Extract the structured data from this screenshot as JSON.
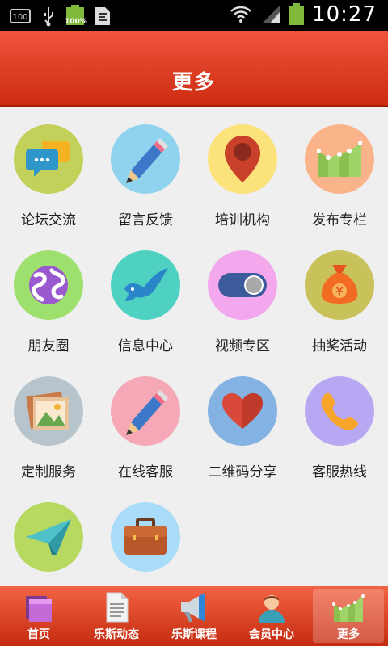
{
  "status_bar": {
    "time": "10:27",
    "battery_small": "100%",
    "indicator": "100"
  },
  "header": {
    "title": "更多"
  },
  "grid": {
    "items": [
      {
        "label": "论坛交流",
        "icon": "chat-bubbles-icon",
        "bg": "#c3d05a"
      },
      {
        "label": "留言反馈",
        "icon": "pencil-icon",
        "bg": "#8fd3ee"
      },
      {
        "label": "培训机构",
        "icon": "map-pin-icon",
        "bg": "#fbe27a"
      },
      {
        "label": "发布专栏",
        "icon": "chart-columns-icon",
        "bg": "#fbb38a"
      },
      {
        "label": "朋友圈",
        "icon": "globe-icon",
        "bg": "#9ee06d"
      },
      {
        "label": "信息中心",
        "icon": "bird-icon",
        "bg": "#4fd1c1"
      },
      {
        "label": "视频专区",
        "icon": "toggle-icon",
        "bg": "#f3a7ec"
      },
      {
        "label": "抽奖活动",
        "icon": "money-bag-icon",
        "bg": "#c9c25a"
      },
      {
        "label": "定制服务",
        "icon": "picture-icon",
        "bg": "#b8c4cc"
      },
      {
        "label": "在线客服",
        "icon": "pencil-icon",
        "bg": "#f6a8b6"
      },
      {
        "label": "二维码分享",
        "icon": "heart-icon",
        "bg": "#84b2e2"
      },
      {
        "label": "客服热线",
        "icon": "phone-icon",
        "bg": "#b8a7f3"
      },
      {
        "label": "",
        "icon": "paper-plane-icon",
        "bg": "#b7d960"
      },
      {
        "label": "",
        "icon": "briefcase-icon",
        "bg": "#a8dcf8"
      }
    ]
  },
  "tabs": [
    {
      "label": "首页",
      "icon": "folder-icon",
      "active": false
    },
    {
      "label": "乐斯动态",
      "icon": "document-icon",
      "active": false
    },
    {
      "label": "乐斯课程",
      "icon": "megaphone-icon",
      "active": false
    },
    {
      "label": "会员中心",
      "icon": "user-icon",
      "active": false
    },
    {
      "label": "更多",
      "icon": "chart-columns-icon",
      "active": true
    }
  ]
}
